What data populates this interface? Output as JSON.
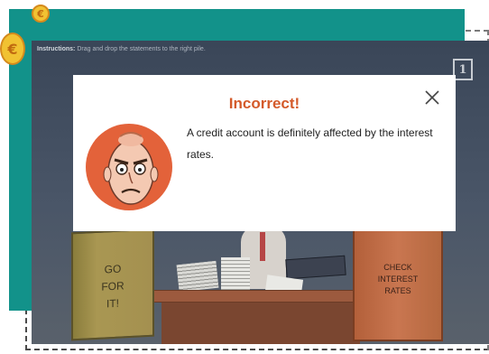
{
  "instructions": {
    "label": "Instructions:",
    "text": "Drag and drop the statements to the right pile."
  },
  "hint_button": {
    "label": "1"
  },
  "coins": {
    "small_symbol": "€",
    "large_symbol": "€"
  },
  "feedback": {
    "title": "Incorrect!",
    "message": "A credit account is definitely affected by the interest rates."
  },
  "cards": {
    "go": "GO\nFOR\nIT!",
    "check": "CHECK\nINTEREST\nRATES"
  },
  "colors": {
    "teal": "#12928a",
    "title": "#d45a2a",
    "stage": "#3a4658"
  }
}
